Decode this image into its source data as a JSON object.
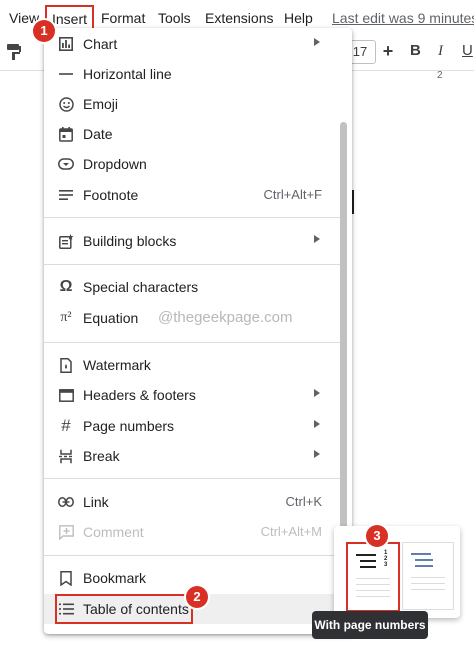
{
  "menubar": {
    "items": [
      {
        "label": "View"
      },
      {
        "label": "Insert"
      },
      {
        "label": "Format"
      },
      {
        "label": "Tools"
      },
      {
        "label": "Extensions"
      },
      {
        "label": "Help"
      }
    ],
    "last_edit": "Last edit was 9 minutes"
  },
  "toolbar": {
    "font_size": "17",
    "plus": "+",
    "bold": "B",
    "italic": "I",
    "underline": "U"
  },
  "ruler": {
    "number": "2"
  },
  "insert_menu": {
    "items": [
      {
        "label": "Chart",
        "icon": "chart-icon",
        "submenu": true
      },
      {
        "label": "Horizontal line",
        "icon": "horizontal-line-icon"
      },
      {
        "label": "Emoji",
        "icon": "emoji-icon"
      },
      {
        "label": "Date",
        "icon": "calendar-icon"
      },
      {
        "label": "Dropdown",
        "icon": "dropdown-chip-icon"
      },
      {
        "label": "Footnote",
        "icon": "footnote-icon",
        "shortcut": "Ctrl+Alt+F"
      },
      {
        "label": "Building blocks",
        "icon": "building-blocks-icon",
        "submenu": true
      },
      {
        "label": "Special characters",
        "icon": "omega-icon"
      },
      {
        "label": "Equation",
        "icon": "pi-squared-icon"
      },
      {
        "label": "Watermark",
        "icon": "watermark-icon"
      },
      {
        "label": "Headers & footers",
        "icon": "headers-footers-icon",
        "submenu": true
      },
      {
        "label": "Page numbers",
        "icon": "hash-icon",
        "submenu": true
      },
      {
        "label": "Break",
        "icon": "break-icon",
        "submenu": true
      },
      {
        "label": "Link",
        "icon": "link-icon",
        "shortcut": "Ctrl+K"
      },
      {
        "label": "Comment",
        "icon": "add-comment-icon",
        "shortcut": "Ctrl+Alt+M",
        "disabled": true
      },
      {
        "label": "Bookmark",
        "icon": "bookmark-icon"
      },
      {
        "label": "Table of contents",
        "icon": "toc-icon",
        "submenu": true,
        "highlighted": true
      }
    ]
  },
  "icon_glyphs": {
    "omega": "Ω",
    "pi_squared": "π²",
    "hash": "#"
  },
  "watermark_text": "@thegeekpage.com",
  "toc_submenu": {
    "tooltip": "With page numbers",
    "page_digits": [
      "1",
      "2",
      "3"
    ]
  },
  "badges": {
    "one": "1",
    "two": "2",
    "three": "3"
  },
  "colors": {
    "annotation_red": "#d93025",
    "hover_gray": "#efefef",
    "tooltip_bg": "#303134"
  }
}
